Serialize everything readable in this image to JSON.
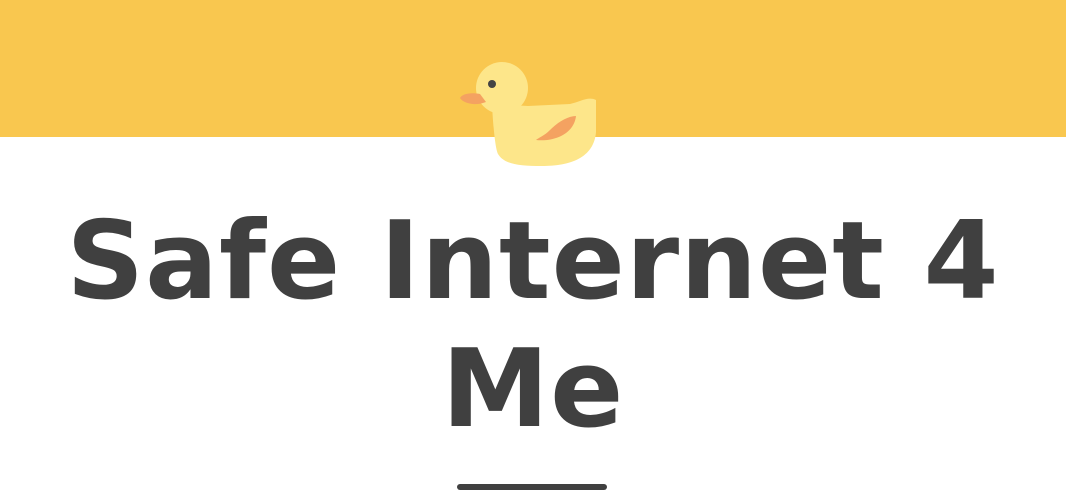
{
  "header": {
    "logo_icon": "duck-icon",
    "band_color": "#f9c74f"
  },
  "hero": {
    "title_line1": "Safe Internet 4",
    "title_line2": "Me",
    "title_color": "#404040"
  }
}
